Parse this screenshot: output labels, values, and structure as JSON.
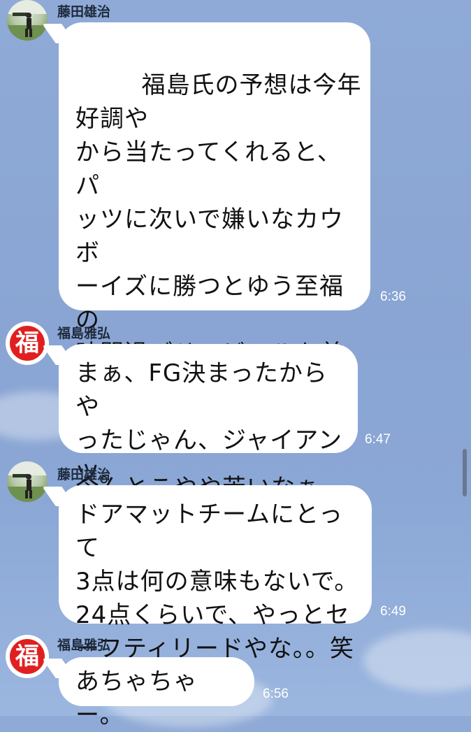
{
  "messages": [
    {
      "sender": "藤田雄治",
      "avatar": "photo-avatar",
      "text": "福島氏の予想は今年好調や\nから当たってくれると、パ\nッツに次いで嫌いなカウボ\nーイズに勝つとゆう至福の\n時間過ごせてビールも美味\nいけどね！\n\n今んとこやや苦いなぁー",
      "emoji": "😅",
      "time": "6:36"
    },
    {
      "sender": "福島雅弘",
      "avatar": "fuku-avatar",
      "avatar_char": "福",
      "text": "まぁ、FG決まったからや\nったじゃん、ジャイアン\nツ。",
      "time": "6:47"
    },
    {
      "sender": "藤田雄治",
      "avatar": "photo-avatar",
      "text": "ドアマットチームにとって\n3点は何の意味もないで。\n24点くらいで、やっとセ\nーフティリードやな。。笑",
      "time": "6:49"
    },
    {
      "sender": "福島雅弘",
      "avatar": "fuku-avatar",
      "avatar_char": "福",
      "text": "あちゃちゃー。",
      "time": "6:56"
    }
  ],
  "colors": {
    "fuku_red": "#e02020",
    "bubble": "#ffffff",
    "background": "#8ba7d5"
  }
}
